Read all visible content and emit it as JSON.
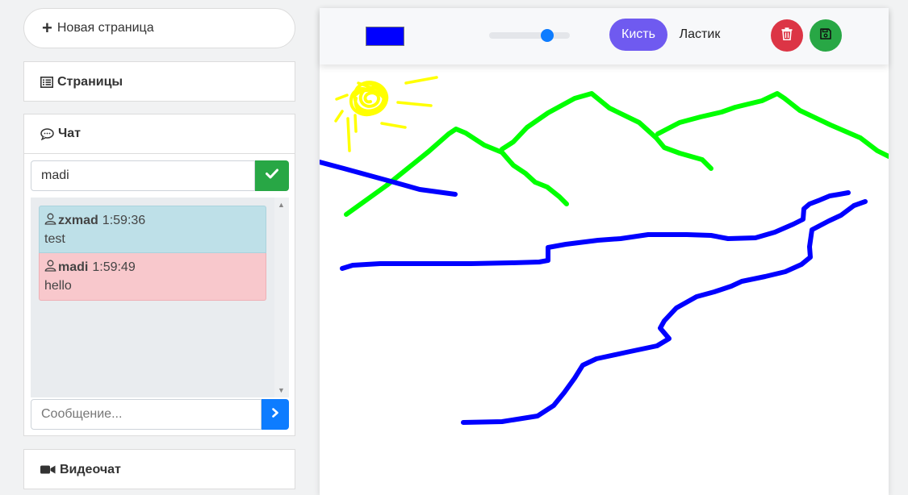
{
  "sidebar": {
    "new_page_label": "Новая страница",
    "pages": {
      "title": "Страницы"
    },
    "chat": {
      "title": "Чат",
      "username_value": "madi",
      "messages": [
        {
          "user": "zxmad",
          "time": "1:59:36",
          "text": "test",
          "kind": "other"
        },
        {
          "user": "madi",
          "time": "1:59:49",
          "text": "hello",
          "kind": "self"
        }
      ],
      "message_placeholder": "Сообщение..."
    },
    "videochat": {
      "title": "Видеочат"
    }
  },
  "toolbar": {
    "brush_color": "#0000ff",
    "brush_size_fraction": 0.7,
    "brush_label": "Кисть",
    "eraser_label": "Ластик",
    "clear_icon": "trash-icon",
    "save_icon": "save-icon"
  },
  "colors": {
    "accent": "#6f5af0",
    "success": "#28a745",
    "danger": "#dc3545",
    "primary": "#0d7cff",
    "msg_other_bg": "#bee0e8",
    "msg_self_bg": "#f8c8cc"
  },
  "drawing": {
    "stroke_colors": [
      "#ffff00",
      "#00ff00",
      "#0000ff"
    ],
    "content": [
      "sun",
      "mountains",
      "river"
    ]
  }
}
